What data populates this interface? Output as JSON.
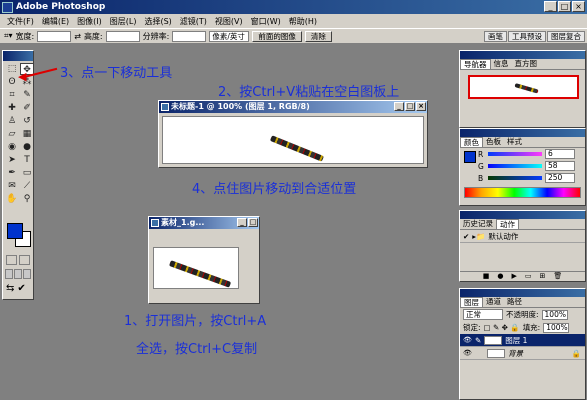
{
  "app": {
    "title": "Adobe Photoshop",
    "window_buttons": [
      "_",
      "□",
      "×"
    ]
  },
  "menu": [
    "文件(F)",
    "编辑(E)",
    "图像(I)",
    "图层(L)",
    "选择(S)",
    "滤镜(T)",
    "视图(V)",
    "窗口(W)",
    "帮助(H)"
  ],
  "options_bar": {
    "width_label": "宽度:",
    "height_label": "高度:",
    "resolution_label": "分辨率:",
    "unit_select": "像素/英寸",
    "front_image_button": "前面的图像",
    "clear_button": "清除",
    "right_tabs": [
      "画笔",
      "工具预设",
      "图层复合"
    ]
  },
  "doc_main": {
    "title": "未标题-1 @ 100% (图层 1, RGB/8)"
  },
  "doc_source": {
    "title": "素材_1.g..."
  },
  "annotations": {
    "step3": "3、点一下移动工具",
    "step2": "2、按Ctrl+V粘贴在空白图板上",
    "step4": "4、点住图片移动到合适位置",
    "step1_line1": "1、打开图片，按Ctrl+A",
    "step1_line2": "全选，按Ctrl+C复制"
  },
  "navigator": {
    "tabs": [
      "导航器",
      "信息",
      "直方图"
    ]
  },
  "color_panel": {
    "tabs": [
      "颜色",
      "色板",
      "样式"
    ],
    "channels": [
      {
        "label": "R",
        "value": "6"
      },
      {
        "label": "G",
        "value": "58"
      },
      {
        "label": "B",
        "value": "250"
      }
    ]
  },
  "history_panel": {
    "tabs": [
      "历史记录",
      "动作"
    ],
    "items": [
      "默认动作"
    ]
  },
  "layers_panel": {
    "tabs": [
      "图层",
      "通道",
      "路径"
    ],
    "blend_mode": "正常",
    "opacity_label": "不透明度:",
    "opacity_value": "100%",
    "lock_label": "锁定:",
    "fill_label": "填充:",
    "fill_value": "100%",
    "layers": [
      {
        "name": "图层 1",
        "selected": true
      },
      {
        "name": "背景",
        "selected": false
      }
    ]
  },
  "colors": {
    "foreground": "#0033cc",
    "background": "#ffffff",
    "annotation_text": "#1a2fd8",
    "arrow": "#dd0000"
  }
}
